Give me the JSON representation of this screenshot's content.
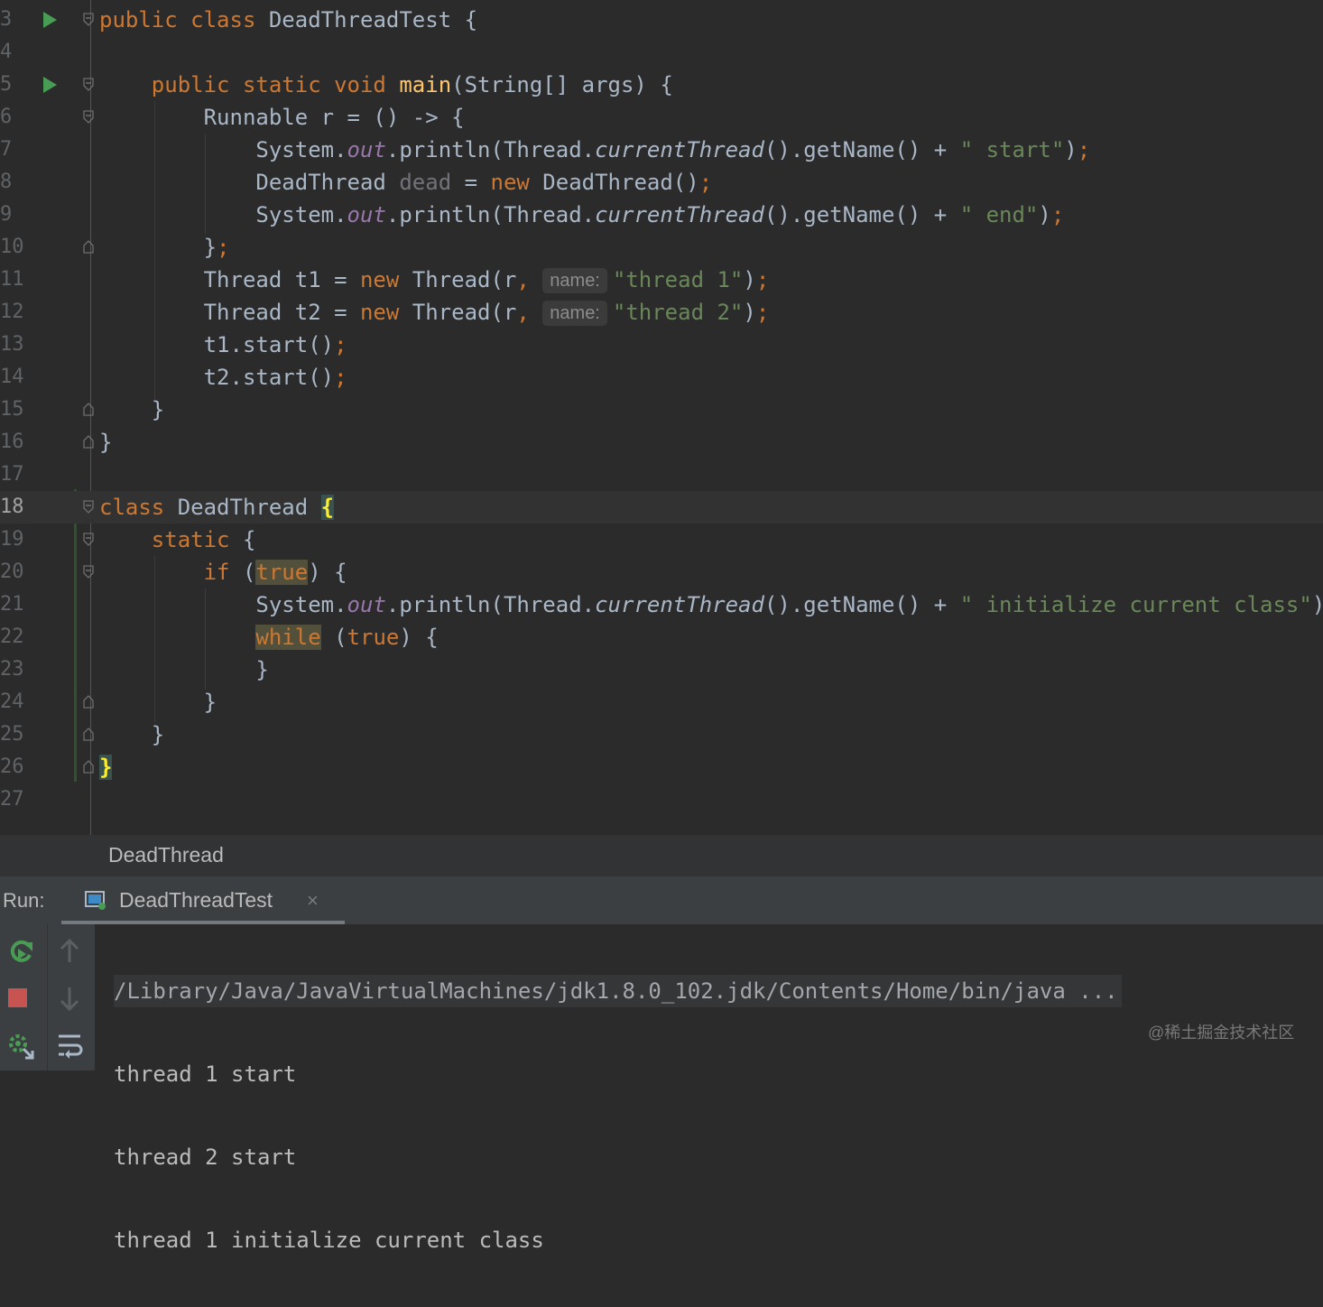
{
  "editor": {
    "lines": [
      {
        "n": "3",
        "parts": [
          [
            "kw",
            "public class "
          ],
          [
            "",
            "DeadThreadTest {"
          ]
        ]
      },
      {
        "n": "4",
        "parts": []
      },
      {
        "n": "5",
        "parts": [
          [
            "",
            "    "
          ],
          [
            "kw",
            "public static void "
          ],
          [
            "fn",
            "main"
          ],
          [
            "",
            "(String[] args) {"
          ]
        ]
      },
      {
        "n": "6",
        "parts": [
          [
            "",
            "        Runnable r = () -> {"
          ]
        ]
      },
      {
        "n": "7",
        "parts": [
          [
            "",
            "            System."
          ],
          [
            "fld",
            "out"
          ],
          [
            "",
            ".println(Thread."
          ],
          [
            "it",
            "currentThread"
          ],
          [
            "",
            "().getName() + "
          ],
          [
            "str",
            "\" start\""
          ],
          [
            "",
            ")"
          ],
          [
            "semi",
            ";"
          ]
        ]
      },
      {
        "n": "8",
        "parts": [
          [
            "",
            "            DeadThread "
          ],
          [
            "unused",
            "dead"
          ],
          [
            "",
            " = "
          ],
          [
            "kw",
            "new "
          ],
          [
            "",
            "DeadThread()"
          ],
          [
            "semi",
            ";"
          ]
        ]
      },
      {
        "n": "9",
        "parts": [
          [
            "",
            "            System."
          ],
          [
            "fld",
            "out"
          ],
          [
            "",
            ".println(Thread."
          ],
          [
            "it",
            "currentThread"
          ],
          [
            "",
            "().getName() + "
          ],
          [
            "str",
            "\" end\""
          ],
          [
            "",
            ")"
          ],
          [
            "semi",
            ";"
          ]
        ]
      },
      {
        "n": "10",
        "parts": [
          [
            "",
            "        }"
          ],
          [
            "semi",
            ";"
          ]
        ]
      },
      {
        "n": "11",
        "parts": [
          [
            "",
            "        Thread t1 = "
          ],
          [
            "kw",
            "new "
          ],
          [
            "",
            "Thread(r"
          ],
          [
            "semi",
            ", "
          ],
          [
            "hint",
            "name:"
          ],
          [
            "str",
            "\"thread 1\""
          ],
          [
            "",
            ")"
          ],
          [
            "semi",
            ";"
          ]
        ]
      },
      {
        "n": "12",
        "parts": [
          [
            "",
            "        Thread t2 = "
          ],
          [
            "kw",
            "new "
          ],
          [
            "",
            "Thread(r"
          ],
          [
            "semi",
            ", "
          ],
          [
            "hint",
            "name:"
          ],
          [
            "str",
            "\"thread 2\""
          ],
          [
            "",
            ")"
          ],
          [
            "semi",
            ";"
          ]
        ]
      },
      {
        "n": "13",
        "parts": [
          [
            "",
            "        t1.start()"
          ],
          [
            "semi",
            ";"
          ]
        ]
      },
      {
        "n": "14",
        "parts": [
          [
            "",
            "        t2.start()"
          ],
          [
            "semi",
            ";"
          ]
        ]
      },
      {
        "n": "15",
        "parts": [
          [
            "",
            "    }"
          ]
        ]
      },
      {
        "n": "16",
        "parts": [
          [
            "",
            "}"
          ]
        ]
      },
      {
        "n": "17",
        "parts": []
      },
      {
        "n": "18",
        "parts": [
          [
            "kw",
            "class "
          ],
          [
            "",
            "DeadThread "
          ],
          [
            "brace",
            "{"
          ]
        ]
      },
      {
        "n": "19",
        "parts": [
          [
            "",
            "    "
          ],
          [
            "kw",
            "static "
          ],
          [
            "",
            "{"
          ]
        ]
      },
      {
        "n": "20",
        "parts": [
          [
            "",
            "        "
          ],
          [
            "kw",
            "if "
          ],
          [
            "",
            "("
          ],
          [
            "kwwarn",
            "true"
          ],
          [
            "",
            ") {"
          ]
        ]
      },
      {
        "n": "21",
        "parts": [
          [
            "",
            "            System."
          ],
          [
            "fld",
            "out"
          ],
          [
            "",
            ".println(Thread."
          ],
          [
            "it",
            "currentThread"
          ],
          [
            "",
            "().getName() + "
          ],
          [
            "str",
            "\" initialize current class\""
          ],
          [
            "",
            ")"
          ],
          [
            "semi",
            ";"
          ]
        ]
      },
      {
        "n": "22",
        "parts": [
          [
            "",
            "            "
          ],
          [
            "kwwarn",
            "while"
          ],
          [
            "",
            " ("
          ],
          [
            "kw",
            "true"
          ],
          [
            "",
            ") {"
          ]
        ]
      },
      {
        "n": "23",
        "parts": [
          [
            "",
            "            }"
          ]
        ]
      },
      {
        "n": "24",
        "parts": [
          [
            "",
            "        }"
          ]
        ]
      },
      {
        "n": "25",
        "parts": [
          [
            "",
            "    }"
          ]
        ]
      },
      {
        "n": "26",
        "parts": [
          [
            "brace",
            "}"
          ]
        ]
      },
      {
        "n": "27",
        "parts": []
      }
    ],
    "current_line": "18",
    "run_markers": [
      "3",
      "5"
    ],
    "fold_open": [
      "3",
      "5",
      "6",
      "18",
      "19",
      "20"
    ],
    "fold_close": [
      "10",
      "15",
      "16",
      "24",
      "25",
      "26"
    ]
  },
  "breadcrumb": {
    "label": "DeadThread"
  },
  "run_panel": {
    "label": "Run:",
    "tab_title": "DeadThreadTest",
    "tab_close": "×"
  },
  "console": {
    "lines": [
      "/Library/Java/JavaVirtualMachines/jdk1.8.0_102.jdk/Contents/Home/bin/java ...",
      "thread 1 start",
      "thread 2 start",
      "thread 1 initialize current class"
    ]
  },
  "watermark": "@稀土掘金技术社区",
  "colors": {
    "background": "#2b2b2b",
    "keyword": "#cc7832",
    "function": "#ffc66d",
    "string": "#6a8759",
    "field": "#9876aa",
    "run_marker": "#499c54",
    "stop": "#c75450"
  }
}
